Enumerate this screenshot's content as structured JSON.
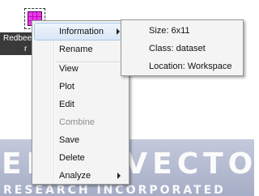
{
  "desktop": {
    "dataset_label_line1": "Redbee",
    "dataset_label_line2": "r",
    "watermark_main": "EIGENVECTOR",
    "watermark_sub": "RESEARCH INCORPORATED"
  },
  "context_menu": {
    "information": "Information",
    "rename": "Rename",
    "view": "View",
    "plot": "Plot",
    "edit": "Edit",
    "combine": "Combine",
    "save": "Save",
    "delete": "Delete",
    "analyze": "Analyze"
  },
  "info_submenu": {
    "size": "Size: 6x11",
    "class": "Class: dataset",
    "location": "Location: Workspace"
  },
  "colors": {
    "dataset_icon": "#cc00cc",
    "highlight": "#d9e7f6"
  }
}
